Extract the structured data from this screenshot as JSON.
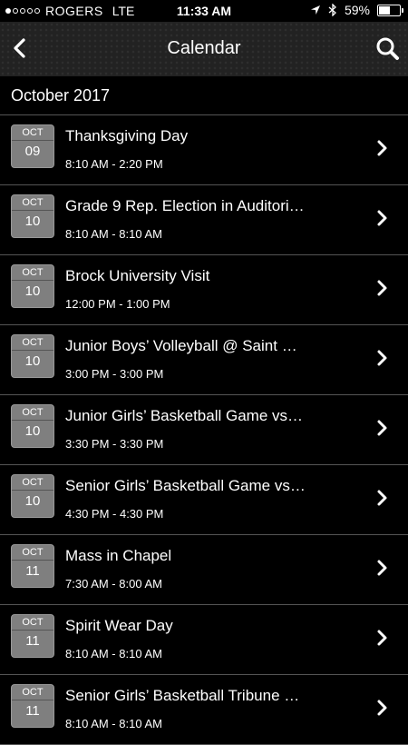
{
  "status_bar": {
    "carrier": "ROGERS",
    "network": "LTE",
    "time": "11:33 AM",
    "battery": "59%",
    "battery_level": 0.59,
    "signal_bars_filled": 1,
    "signal_bars_total": 5
  },
  "header": {
    "title": "Calendar",
    "back_icon": "chevron-left-icon",
    "search_icon": "search-icon"
  },
  "section": {
    "title": "October 2017"
  },
  "events": [
    {
      "month": "OCT",
      "day": "09",
      "title": "Thanksgiving Day",
      "time": "8:10 AM - 2:20 PM"
    },
    {
      "month": "OCT",
      "day": "10",
      "title": "Grade 9 Rep. Election in Auditori…",
      "time": "8:10 AM - 8:10 AM"
    },
    {
      "month": "OCT",
      "day": "10",
      "title": "Brock University Visit",
      "time": "12:00 PM - 1:00 PM"
    },
    {
      "month": "OCT",
      "day": "10",
      "title": "Junior Boys’ Volleyball @ Saint …",
      "time": "3:00 PM - 3:00 PM"
    },
    {
      "month": "OCT",
      "day": "10",
      "title": "Junior Girls’ Basketball Game vs…",
      "time": "3:30 PM - 3:30 PM"
    },
    {
      "month": "OCT",
      "day": "10",
      "title": "Senior Girls’ Basketball Game vs…",
      "time": "4:30 PM - 4:30 PM"
    },
    {
      "month": "OCT",
      "day": "11",
      "title": "Mass in Chapel",
      "time": "7:30 AM - 8:00 AM"
    },
    {
      "month": "OCT",
      "day": "11",
      "title": "Spirit Wear Day",
      "time": "8:10 AM - 8:10 AM"
    },
    {
      "month": "OCT",
      "day": "11",
      "title": "Senior Girls’ Basketball Tribune …",
      "time": "8:10 AM - 8:10 AM"
    }
  ]
}
